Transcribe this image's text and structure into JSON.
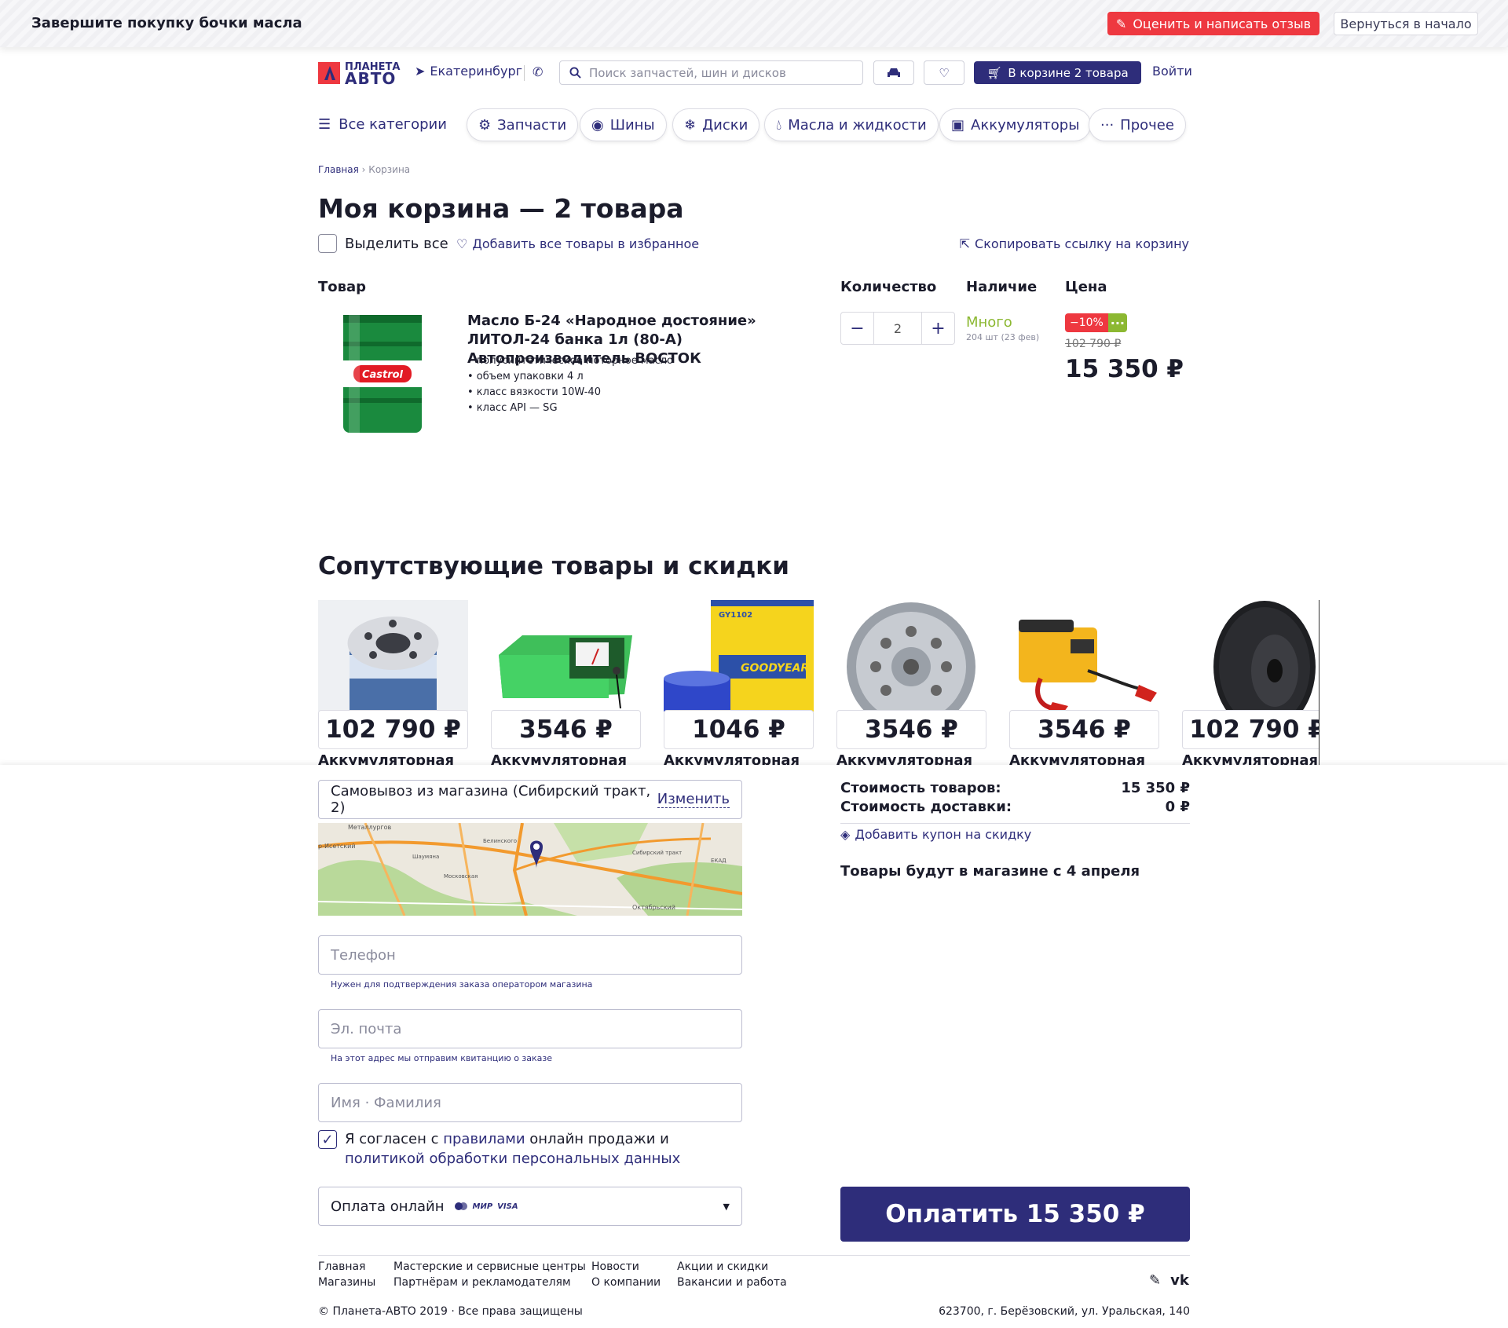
{
  "taskbar": {
    "task": "Завершите покупку бочки масла",
    "review_button": "Оценить и написать отзыв",
    "back_button": "Вернуться в начало"
  },
  "header": {
    "logo_line1": "ПЛАНЕТА",
    "logo_line2": "АВТО",
    "city": "Екатеринбург",
    "search_placeholder": "Поиск запчастей, шин и дисков",
    "cart_button": "В корзине 2 товара",
    "login": "Войти"
  },
  "nav": {
    "all_categories": "Все категории",
    "chips": [
      {
        "label": "Запчасти",
        "icon": "gear-icon"
      },
      {
        "label": "Шины",
        "icon": "tire-icon"
      },
      {
        "label": "Диски",
        "icon": "wheel-icon"
      },
      {
        "label": "Масла и жидкости",
        "icon": "drop-icon"
      },
      {
        "label": "Аккумуляторы",
        "icon": "battery-icon"
      },
      {
        "label": "Прочее",
        "icon": "more-icon"
      }
    ]
  },
  "breadcrumb": {
    "home": "Главная",
    "current": "Корзина"
  },
  "cart": {
    "title": "Моя корзина — 2 товара",
    "select_all": "Выделить все",
    "add_all_fav": "Добавить все товары в избранное",
    "copy_link": "Скопировать ссылку на корзину",
    "columns": {
      "product": "Товар",
      "quantity": "Количество",
      "availability": "Наличие",
      "price": "Цена"
    },
    "item": {
      "title": "Масло Б-24 «Народное достояние» ЛИТОЛ-24 банка 1л (80-А) Автопроизводитель ВОСТОК",
      "specs": [
        "• полусинтетическое моторное масло",
        "• объем упаковки 4 л",
        "• класс вязкости 10W-40",
        "• класс API — SG"
      ],
      "quantity": "2",
      "availability": "Много",
      "availability_detail": "204 шт (23 фев)",
      "discount": "−10%",
      "old_price": "102 790 ₽",
      "price": "15 350 ₽"
    }
  },
  "related": {
    "title": "Сопутствующие товары и скидки",
    "items": [
      {
        "price": "102 790 ₽",
        "name": "Аккумуляторная"
      },
      {
        "price": "3546 ₽",
        "name": "Аккумуляторная"
      },
      {
        "price": "1046 ₽",
        "name": "Аккумуляторная"
      },
      {
        "price": "3546 ₽",
        "name": "Аккумуляторная"
      },
      {
        "price": "3546 ₽",
        "name": "Аккумуляторная"
      },
      {
        "price": "102 790 ₽",
        "name": "Аккумуляторная"
      }
    ]
  },
  "checkout": {
    "pickup": "Самовывоз из магазина (Сибирский тракт, 2)",
    "change": "Изменить",
    "map_labels": [
      "Металлургов",
      "р-Исетский",
      "Шаумяна",
      "Московская",
      "Белинского",
      "Сибирский тракт",
      "Октябрьский",
      "ЕКАД"
    ],
    "phone_placeholder": "Телефон",
    "phone_hint": "Нужен для подтверждения заказа оператором магазина",
    "email_placeholder": "Эл. почта",
    "email_hint": "На этот адрес мы отправим квитанцию о заказе",
    "name_placeholder": "Имя · Фамилия",
    "agree_prefix": "Я согласен с ",
    "agree_rules": "правилами",
    "agree_mid": " онлайн продажи и",
    "agree_policy": "политикой обработки персональных данных",
    "payment": "Оплата онлайн",
    "payment_cards": [
      "МИР",
      "VISA"
    ]
  },
  "summary": {
    "goods_label": "Стоимость товаров:",
    "goods_value": "15 350 ₽",
    "delivery_label": "Стоимость доставки:",
    "delivery_value": "0 ₽",
    "coupon": "Добавить купон на скидку",
    "ready": "Товары будут в магазине с 4 апреля",
    "pay_button": "Оплатить 15 350 ₽"
  },
  "footer": {
    "col1": [
      "Главная",
      "Магазины"
    ],
    "col2": [
      "Мастерские и сервисные центры",
      "Партнёрам и рекламодателям"
    ],
    "col3": [
      "Новости",
      "О компании"
    ],
    "col4": [
      "Акции и скидки",
      "Вакансии и работа"
    ],
    "copyright": "© Планета-АВТО 2019 · Все права защищены",
    "address": "623700, г. Берёзовский, ул. Уральская, 140"
  },
  "colors": {
    "brand": "#2e2d7a",
    "accent_red": "#ee3840",
    "green": "#8cb832"
  }
}
